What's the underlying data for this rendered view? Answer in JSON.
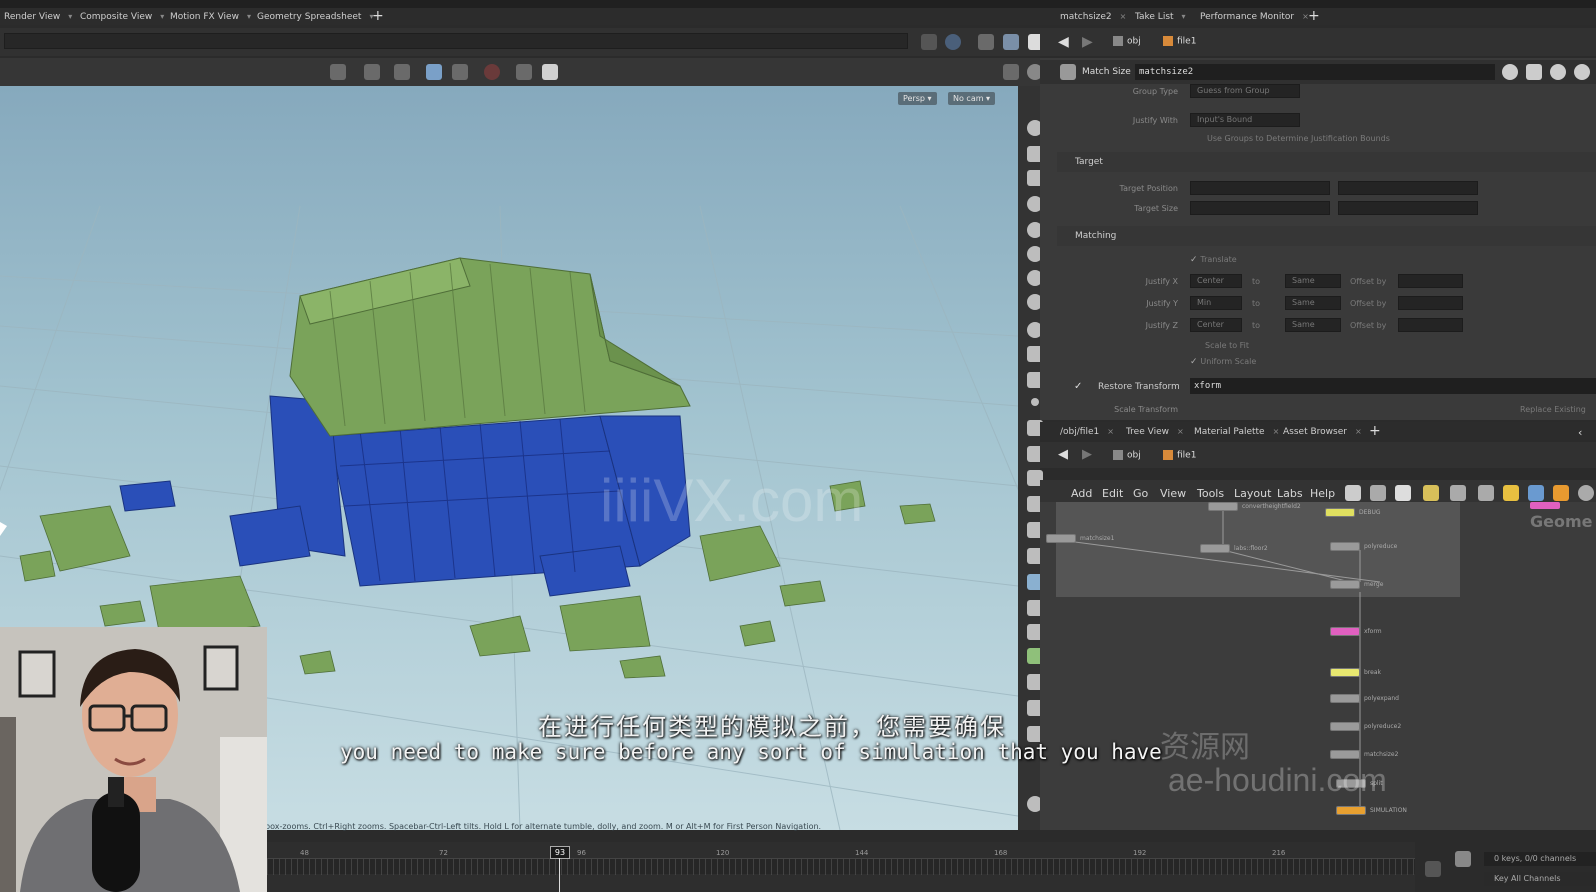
{
  "top_tabs": [
    "Render View",
    "Composite View",
    "Motion FX View",
    "Geometry Spreadsheet"
  ],
  "right_tabs": [
    "matchsize2",
    "Take List",
    "Performance Monitor"
  ],
  "path_top": {
    "root": "obj",
    "node": "file1"
  },
  "viewport": {
    "persp_label": "Persp",
    "cam_label": "No cam",
    "status_text": "box-zooms. Ctrl+Right zooms. Spacebar-Ctrl-Left tilts. Hold L for alternate tumble, dolly, and zoom.    M or Alt+M for First Person Navigation."
  },
  "params": {
    "title_label": "Match Size",
    "node_name": "matchsize2",
    "group_type_label": "Group Type",
    "group_type_value": "Guess from Group",
    "justify_with_label": "Justify With",
    "justify_with_value": "Input's Bound",
    "use_groups_label": "Use Groups to Determine Justification Bounds",
    "target_header": "Target",
    "target_position_label": "Target Position",
    "target_size_label": "Target Size",
    "matching_header": "Matching",
    "translate_label": "Translate",
    "justify_x_label": "Justify X",
    "justify_x_value": "Center",
    "justify_y_label": "Justify Y",
    "justify_y_value": "Min",
    "justify_z_label": "Justify Z",
    "justify_z_value": "Center",
    "to_label": "to",
    "same_label": "Same",
    "offset_label": "Offset by",
    "scale_to_fit_label": "Scale to Fit",
    "uniform_scale_label": "Uniform Scale",
    "restore_transform_label": "Restore Transform",
    "restore_transform_value": "xform",
    "scale_transform_label": "Scale Transform",
    "replace_existing_label": "Replace Existing"
  },
  "network": {
    "tabs": [
      "/obj/file1",
      "Tree View",
      "Material Palette",
      "Asset Browser"
    ],
    "path": {
      "root": "obj",
      "node": "file1"
    },
    "menu": [
      "Add",
      "Edit",
      "Go",
      "View",
      "Tools",
      "Layout",
      "Labs",
      "Help"
    ],
    "geometry_label": "Geome"
  },
  "nodes": [
    {
      "label": "convertheightfield2",
      "color": "#9a9a9a"
    },
    {
      "label": "labs::floor2",
      "color": "#9a9a9a"
    },
    {
      "label": "DEBUG",
      "color": "#e0e060"
    },
    {
      "label": "matchsize1",
      "color": "#9a9a9a"
    },
    {
      "label": "polyreduce",
      "color": "#9a9a9a"
    },
    {
      "label": "merge",
      "color": "#9a9a9a"
    },
    {
      "label": "xform",
      "color": "#e060c0"
    },
    {
      "label": "break",
      "color": "#e8e870"
    },
    {
      "label": "polyexpand",
      "color": "#9a9a9a"
    },
    {
      "label": "polyreduce2",
      "color": "#9a9a9a"
    },
    {
      "label": "matchsize2",
      "color": "#9a9a9a"
    },
    {
      "label": "split",
      "color": "#9a9a9a"
    },
    {
      "label": "SIMULATION",
      "color": "#e8a030"
    }
  ],
  "subtitles": {
    "cn": "在进行任何类型的模拟之前，您需要确保",
    "en": "you need to make sure before any sort of simulation that you have"
  },
  "watermarks": {
    "main": "iiiiVX.com",
    "cn": "资源网",
    "sub": "ae-houdini.com"
  },
  "timeline": {
    "current_frame": "93",
    "ticks": [
      "48",
      "72",
      "96",
      "120",
      "144",
      "168",
      "192",
      "216"
    ],
    "keys_text": "0 keys, 0/0 channels",
    "key_all_label": "Key All Channels"
  },
  "colors": {
    "accent": "#e8a030",
    "sky_top": "#86a9bd",
    "sky_bottom": "#c7dde3",
    "roof_green": "#7aa35a",
    "wall_blue": "#2a4fb8"
  }
}
